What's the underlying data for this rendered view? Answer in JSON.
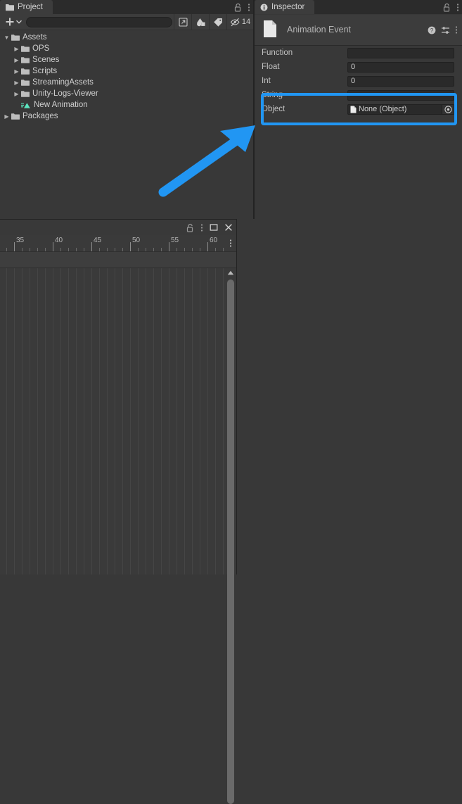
{
  "project": {
    "tab_label": "Project",
    "tab_icon": "folder-icon",
    "lock_icon": "lock-open-icon",
    "menu_icon": "kebab-menu-icon",
    "toolbar": {
      "create_label": "+",
      "create_icon": "plus-icon",
      "create_dropdown_icon": "chevron-down-icon",
      "search_placeholder": "",
      "search_value": "",
      "search_icon": "search-icon",
      "save_search_icon": "save-search-icon",
      "type_filter_icon": "shapes-filter-icon",
      "label_filter_icon": "tag-icon",
      "hidden_icon": "eye-slash-icon",
      "hidden_count": "14"
    },
    "tree": [
      {
        "label": "Assets",
        "icon": "folder-icon",
        "depth": 0,
        "twisty": "▼",
        "expanded": true
      },
      {
        "label": "OPS",
        "icon": "folder-icon",
        "depth": 1,
        "twisty": "▶",
        "expanded": false
      },
      {
        "label": "Scenes",
        "icon": "folder-icon",
        "depth": 1,
        "twisty": "▶",
        "expanded": false
      },
      {
        "label": "Scripts",
        "icon": "folder-icon",
        "depth": 1,
        "twisty": "▶",
        "expanded": false
      },
      {
        "label": "StreamingAssets",
        "icon": "folder-icon",
        "depth": 1,
        "twisty": "▶",
        "expanded": false
      },
      {
        "label": "Unity-Logs-Viewer",
        "icon": "folder-icon",
        "depth": 1,
        "twisty": "▶",
        "expanded": false
      },
      {
        "label": "New Animation",
        "icon": "animation-clip-icon",
        "depth": 1,
        "twisty": "",
        "expanded": false
      },
      {
        "label": "Packages",
        "icon": "folder-icon",
        "depth": 0,
        "twisty": "▶",
        "expanded": false
      }
    ]
  },
  "inspector": {
    "tab_label": "Inspector",
    "tab_icon": "info-icon",
    "lock_icon": "lock-open-icon",
    "menu_icon": "kebab-menu-icon",
    "header": {
      "title": "Animation Event",
      "asset_icon": "document-icon",
      "help_icon": "help-icon",
      "preset_icon": "preset-icon",
      "menu_icon": "kebab-menu-icon"
    },
    "fields": [
      {
        "name": "Function",
        "value": "",
        "placeholder": "",
        "type": "text",
        "highlighted": false
      },
      {
        "name": "Float",
        "value": "0",
        "placeholder": "",
        "type": "number",
        "highlighted": false
      },
      {
        "name": "Int",
        "value": "0",
        "placeholder": "",
        "type": "number",
        "highlighted": false
      },
      {
        "name": "String",
        "value": "",
        "placeholder": "",
        "type": "text",
        "highlighted": true
      },
      {
        "name": "Object",
        "value": "None (Object)",
        "placeholder": "",
        "type": "object",
        "highlighted": true,
        "value_icon": "document-icon",
        "picker_icon": "object-picker-icon"
      }
    ]
  },
  "annotation": {
    "highlight_color": "#2196f3",
    "arrow_color": "#2196f3",
    "highlight_target": "String and Object rows",
    "arrow_points_to": "inspector-fields-highlight"
  },
  "animation_window": {
    "lock_icon": "lock-open-icon",
    "menu_icon": "kebab-menu-icon",
    "maximize_icon": "maximize-icon",
    "close_icon": "close-icon",
    "ruler_menu_icon": "kebab-menu-icon",
    "ruler": {
      "labels": [
        "35",
        "40",
        "45",
        "50",
        "55",
        "60"
      ],
      "major_positions": [
        20,
        75,
        130,
        185,
        240,
        295
      ],
      "minor_step": 11,
      "unit": "frames"
    },
    "scrollbar": {
      "up_arrow_icon": "triangle-up-icon",
      "orientation": "vertical"
    }
  }
}
